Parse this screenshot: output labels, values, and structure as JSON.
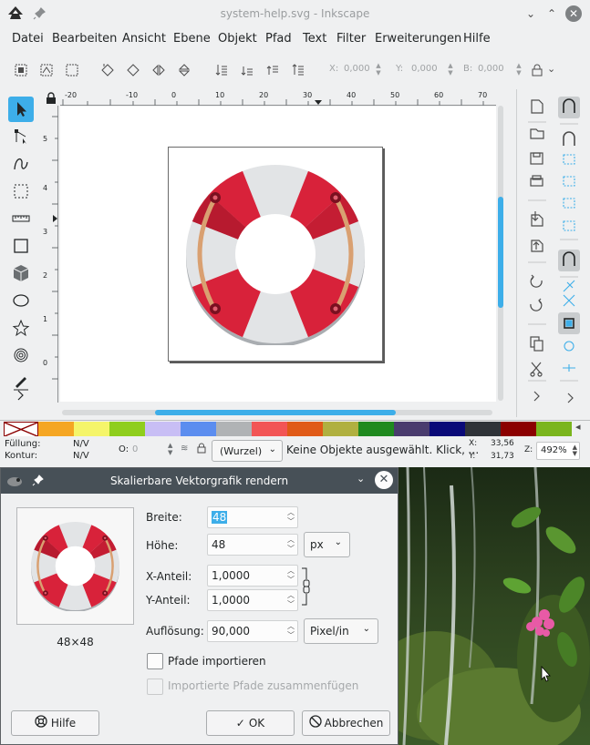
{
  "window": {
    "title": "system-help.svg - Inkscape"
  },
  "menu": [
    "Datei",
    "Bearbeiten",
    "Ansicht",
    "Ebene",
    "Objekt",
    "Pfad",
    "Text",
    "Filter",
    "Erweiterungen",
    "Hilfe"
  ],
  "toolbar": {
    "x_label": "X:",
    "x_value": "0,000",
    "y_label": "Y:",
    "y_value": "0,000",
    "w_label": "B:",
    "w_value": "0,000"
  },
  "ruler": {
    "top": [
      "-20",
      "-10",
      "0",
      "10",
      "20",
      "30",
      "40",
      "50",
      "60",
      "70"
    ],
    "left": [
      "5",
      "4",
      "3",
      "2",
      "1",
      "0"
    ]
  },
  "palette_colors": [
    "#f5a623",
    "#f5f56a",
    "#8fce1d",
    "#c8bef5",
    "#5b8def",
    "#b0b3b5",
    "#f25555",
    "#e05a17",
    "#b0b040",
    "#1f8a1f",
    "#4a3c6e",
    "#0a0a78",
    "#2f3338",
    "#8b0000",
    "#7ab51d"
  ],
  "status": {
    "fill_label": "Füllung:",
    "fill_value": "N/V",
    "stroke_label": "Kontur:",
    "stroke_value": "N/V",
    "opacity_label": "O:",
    "opacity_value": "0",
    "layer": "(Wurzel)",
    "message": "Keine Objekte ausgewählt. Klick, ...",
    "x_label": "X:",
    "x_value": "33,56",
    "y_label": "Y:",
    "y_value": "31,73",
    "zoom_label": "Z:",
    "zoom_value": "492%"
  },
  "dialog": {
    "title": "Skalierbare Vektorgrafik rendern",
    "preview_size": "48×48",
    "width_label": "Breite:",
    "width_value": "48",
    "height_label": "Höhe:",
    "height_value": "48",
    "unit": "px",
    "xscale_label": "X-Anteil:",
    "xscale_value": "1,0000",
    "yscale_label": "Y-Anteil:",
    "yscale_value": "1,0000",
    "resolution_label": "Auflösung:",
    "resolution_value": "90,000",
    "resolution_unit": "Pixel/in",
    "import_paths": "Pfade importieren",
    "merge_paths": "Importierte Pfade zusammenfügen",
    "help_button": "Hilfe",
    "ok_button": "OK",
    "cancel_button": "Abbrechen"
  },
  "colors": {
    "accent": "#3daee9",
    "dialog_title_bg": "#475057",
    "lifebuoy_red": "#d8223a",
    "lifebuoy_white": "#e2e4e6"
  }
}
